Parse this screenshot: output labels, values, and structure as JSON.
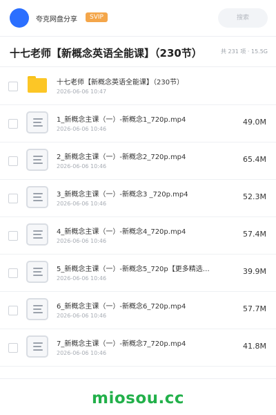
{
  "header": {
    "app_name": "夸克网盘分享",
    "vip_badge": "SVIP",
    "search_placeholder": "搜索",
    "avatar_color": "#2b6fff"
  },
  "folder": {
    "title": "十七老师【新概念英语全能课】（230节）",
    "summary": "共 231 项 · 15.5G"
  },
  "items": [
    {
      "type": "folder",
      "name": "十七老师【新概念英语全能课】（230节）",
      "date": "2026-06-06 10:47",
      "size": ""
    },
    {
      "type": "file",
      "name": "1_新概念主课（一）-新概念1_720p.mp4",
      "date": "2026-06-06 10:46",
      "size": "49.0M"
    },
    {
      "type": "file",
      "name": "2_新概念主课（一）-新概念2_720p.mp4",
      "date": "2026-06-06 10:46",
      "size": "65.4M"
    },
    {
      "type": "file",
      "name": "3_新概念主课（一）-新概念3 _720p.mp4",
      "date": "2026-06-06 10:46",
      "size": "52.3M"
    },
    {
      "type": "file",
      "name": "4_新概念主课（一）-新概念4_720p.mp4",
      "date": "2026-06-06 10:46",
      "size": "57.4M"
    },
    {
      "type": "file",
      "name": "5_新概念主课（一）-新概念5_720p【更多精选…",
      "date": "2026-06-06 10:46",
      "size": "39.9M"
    },
    {
      "type": "file",
      "name": "6_新概念主课（一）-新概念6_720p.mp4",
      "date": "2026-06-06 10:46",
      "size": "57.7M"
    },
    {
      "type": "file",
      "name": "7_新概念主课（一）-新概念7_720p.mp4",
      "date": "2026-06-06 10:46",
      "size": "41.8M"
    }
  ],
  "watermark": "miosou.cc",
  "colors": {
    "folder_yellow": "#fcc626",
    "vip_orange": "#f4a64a",
    "watermark_green": "#22b04a"
  }
}
